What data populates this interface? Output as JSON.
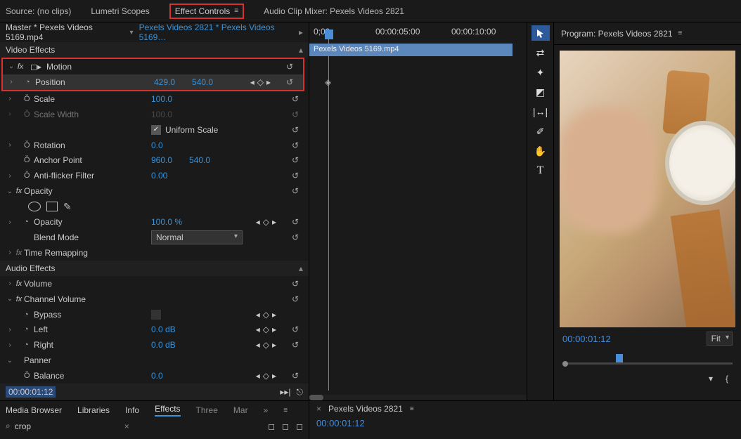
{
  "top_tabs": {
    "source": "Source: (no clips)",
    "lumetri": "Lumetri Scopes",
    "effect_controls": "Effect Controls",
    "audio_mixer": "Audio Clip Mixer: Pexels Videos 2821"
  },
  "sequence_row": {
    "master": "Master * Pexels Videos 5169.mp4",
    "seq": "Pexels Videos 2821 * Pexels Videos 5169…"
  },
  "sections": {
    "video_effects": "Video Effects",
    "audio_effects": "Audio Effects"
  },
  "motion": {
    "label": "Motion",
    "position": {
      "label": "Position",
      "x": "429.0",
      "y": "540.0"
    },
    "scale": {
      "label": "Scale",
      "value": "100.0"
    },
    "scale_width": {
      "label": "Scale Width",
      "value": "100.0"
    },
    "uniform": "Uniform Scale",
    "rotation": {
      "label": "Rotation",
      "value": "0.0"
    },
    "anchor": {
      "label": "Anchor Point",
      "x": "960.0",
      "y": "540.0"
    },
    "anti_flicker": {
      "label": "Anti-flicker Filter",
      "value": "0.00"
    }
  },
  "opacity": {
    "label": "Opacity",
    "opacity": {
      "label": "Opacity",
      "value": "100.0 %"
    },
    "blend": {
      "label": "Blend Mode",
      "value": "Normal"
    }
  },
  "time_remap": "Time Remapping",
  "volume": "Volume",
  "channel_volume": {
    "label": "Channel Volume",
    "bypass": "Bypass",
    "left": {
      "label": "Left",
      "value": "0.0 dB"
    },
    "right": {
      "label": "Right",
      "value": "0.0 dB"
    }
  },
  "panner": {
    "label": "Panner",
    "balance": {
      "label": "Balance",
      "value": "0.0"
    }
  },
  "footer_time": "00:00:01:12",
  "timeline": {
    "t0": "0;00",
    "t1": "00:00:05:00",
    "t2": "00:00:10:00",
    "clip": "Pexels Videos 5169.mp4"
  },
  "tools": [
    "selection",
    "ripple",
    "safe-margins",
    "marker",
    "in-out",
    "eyedropper",
    "hand",
    "type"
  ],
  "program": {
    "title": "Program: Pexels Videos 2821",
    "time": "00:00:01:12",
    "fit": "Fit"
  },
  "bottom_tabs": {
    "media": "Media Browser",
    "libraries": "Libraries",
    "info": "Info",
    "effects": "Effects",
    "three": "Three",
    "mar": "Mar"
  },
  "search": "crop",
  "bottom_right": {
    "tab": "Pexels Videos 2821",
    "time": "00:00:01:12"
  }
}
